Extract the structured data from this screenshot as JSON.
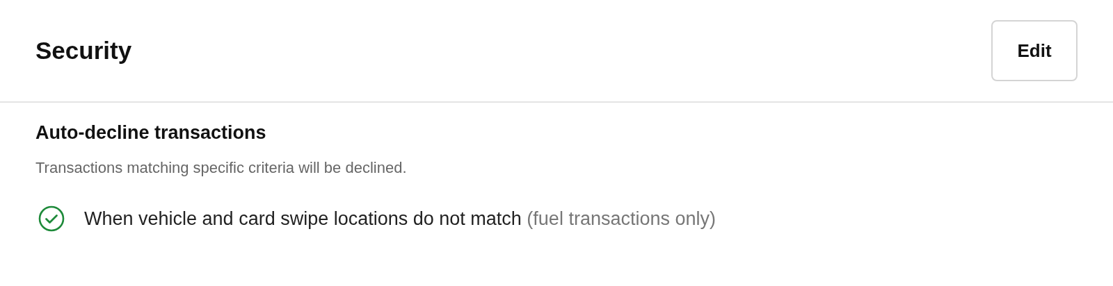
{
  "header": {
    "title": "Security",
    "edit_button": "Edit"
  },
  "section": {
    "title": "Auto-decline transactions",
    "description": "Transactions matching specific criteria will be declined.",
    "rules": [
      {
        "text": "When vehicle and card swipe locations do not match",
        "note": "(fuel transactions only)",
        "checked": true
      }
    ]
  }
}
